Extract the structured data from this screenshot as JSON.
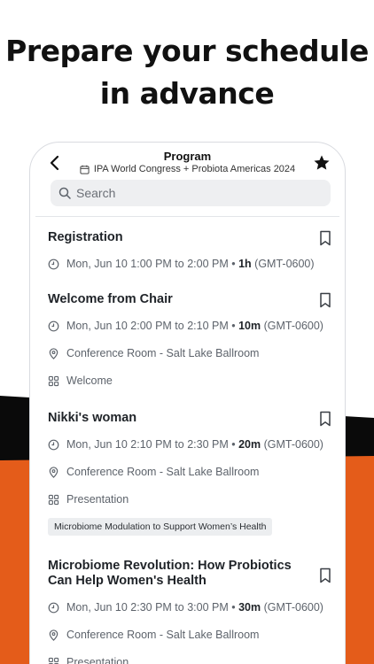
{
  "headline": {
    "line1": "Prepare your schedule",
    "line2": "in advance"
  },
  "colors": {
    "accent": "#E45C1A",
    "black": "#0a0a0a"
  },
  "nav": {
    "title": "Program",
    "subtitle": "IPA World Congress + Probiota Americas 2024",
    "search_placeholder": "Search"
  },
  "sessions": [
    {
      "title": "Registration",
      "time": "Mon, Jun 10 1:00 PM to 2:00 PM",
      "duration": "1h",
      "tz": "(GMT-0600)"
    },
    {
      "title": "Welcome from Chair",
      "time": "Mon, Jun 10 2:00 PM to 2:10 PM",
      "duration": "10m",
      "tz": "(GMT-0600)",
      "location": "Conference Room - Salt Lake Ballroom",
      "type": "Welcome"
    },
    {
      "title": "Nikki's woman",
      "time": "Mon, Jun 10 2:10 PM to 2:30 PM",
      "duration": "20m",
      "tz": "(GMT-0600)",
      "location": "Conference Room - Salt Lake Ballroom",
      "type": "Presentation",
      "tag": "Microbiome Modulation to Support Women’s Health"
    },
    {
      "title": "Microbiome Revolution: How Probiotics Can Help Women's Health",
      "time": "Mon, Jun 10 2:30 PM to 3:00 PM",
      "duration": "30m",
      "tz": "(GMT-0600)",
      "location": "Conference Room - Salt Lake Ballroom",
      "type": "Presentation"
    }
  ]
}
